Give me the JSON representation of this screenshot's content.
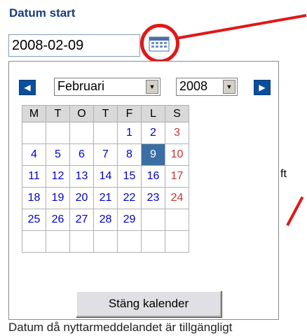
{
  "field": {
    "label": "Datum start",
    "value": "2008-02-09"
  },
  "calendar": {
    "month": "Februari",
    "year": "2008",
    "weekdays": [
      "M",
      "T",
      "O",
      "T",
      "F",
      "L",
      "S"
    ],
    "weeks": [
      [
        "",
        "",
        "",
        "",
        "1",
        "2",
        "3"
      ],
      [
        "4",
        "5",
        "6",
        "7",
        "8",
        "9",
        "10"
      ],
      [
        "11",
        "12",
        "13",
        "14",
        "15",
        "16",
        "17"
      ],
      [
        "18",
        "19",
        "20",
        "21",
        "22",
        "23",
        "24"
      ],
      [
        "25",
        "26",
        "27",
        "28",
        "29",
        "",
        ""
      ],
      [
        "",
        "",
        "",
        "",
        "",
        "",
        ""
      ]
    ],
    "selected_day": "9",
    "close_label": "Stäng kalender",
    "prev_icon": "chevron-left-icon",
    "next_icon": "chevron-right-icon"
  },
  "background": {
    "peek_text": "ft",
    "bottom_text": "Datum då nyttarmeddelandet är tillgängligt"
  },
  "colors": {
    "label": "#1a3d7c",
    "nav_button": "#0b4f9c",
    "selected_day": "#3a6ea5",
    "sunday": "#cc3333",
    "day_number": "#0000d0",
    "highlight": "#e01818"
  }
}
